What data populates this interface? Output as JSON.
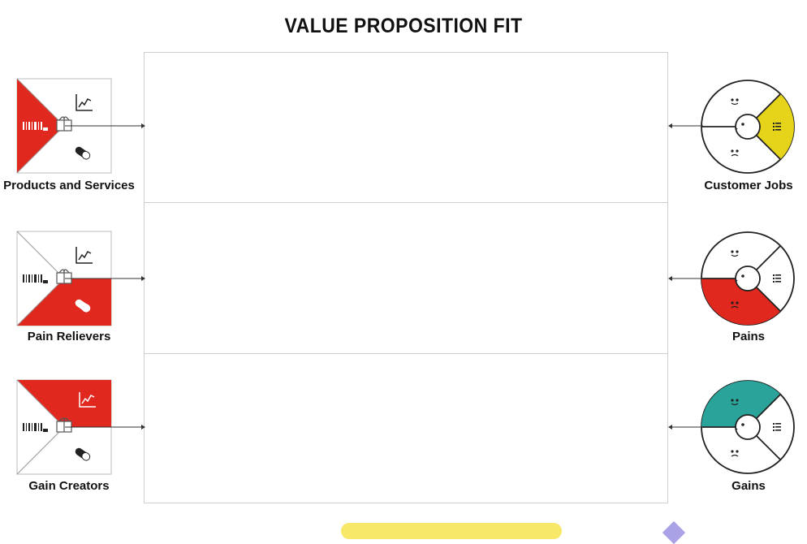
{
  "title": "VALUE PROPOSITION FIT",
  "left_items": [
    {
      "label": "Products and Services",
      "highlight": "left-triangle",
      "color": "#e0281e"
    },
    {
      "label": "Pain Relievers",
      "highlight": "bottom-right",
      "color": "#e0281e"
    },
    {
      "label": "Gain Creators",
      "highlight": "top-right",
      "color": "#e0281e"
    }
  ],
  "right_items": [
    {
      "label": "Customer Jobs",
      "highlight": "jobs",
      "color": "#e6d41a"
    },
    {
      "label": "Pains",
      "highlight": "pains",
      "color": "#e0281e"
    },
    {
      "label": "Gains",
      "highlight": "gains",
      "color": "#2aa39a"
    }
  ],
  "colors": {
    "red": "#e0281e",
    "yellow": "#e6d41a",
    "teal": "#2aa39a",
    "line": "#222222"
  }
}
